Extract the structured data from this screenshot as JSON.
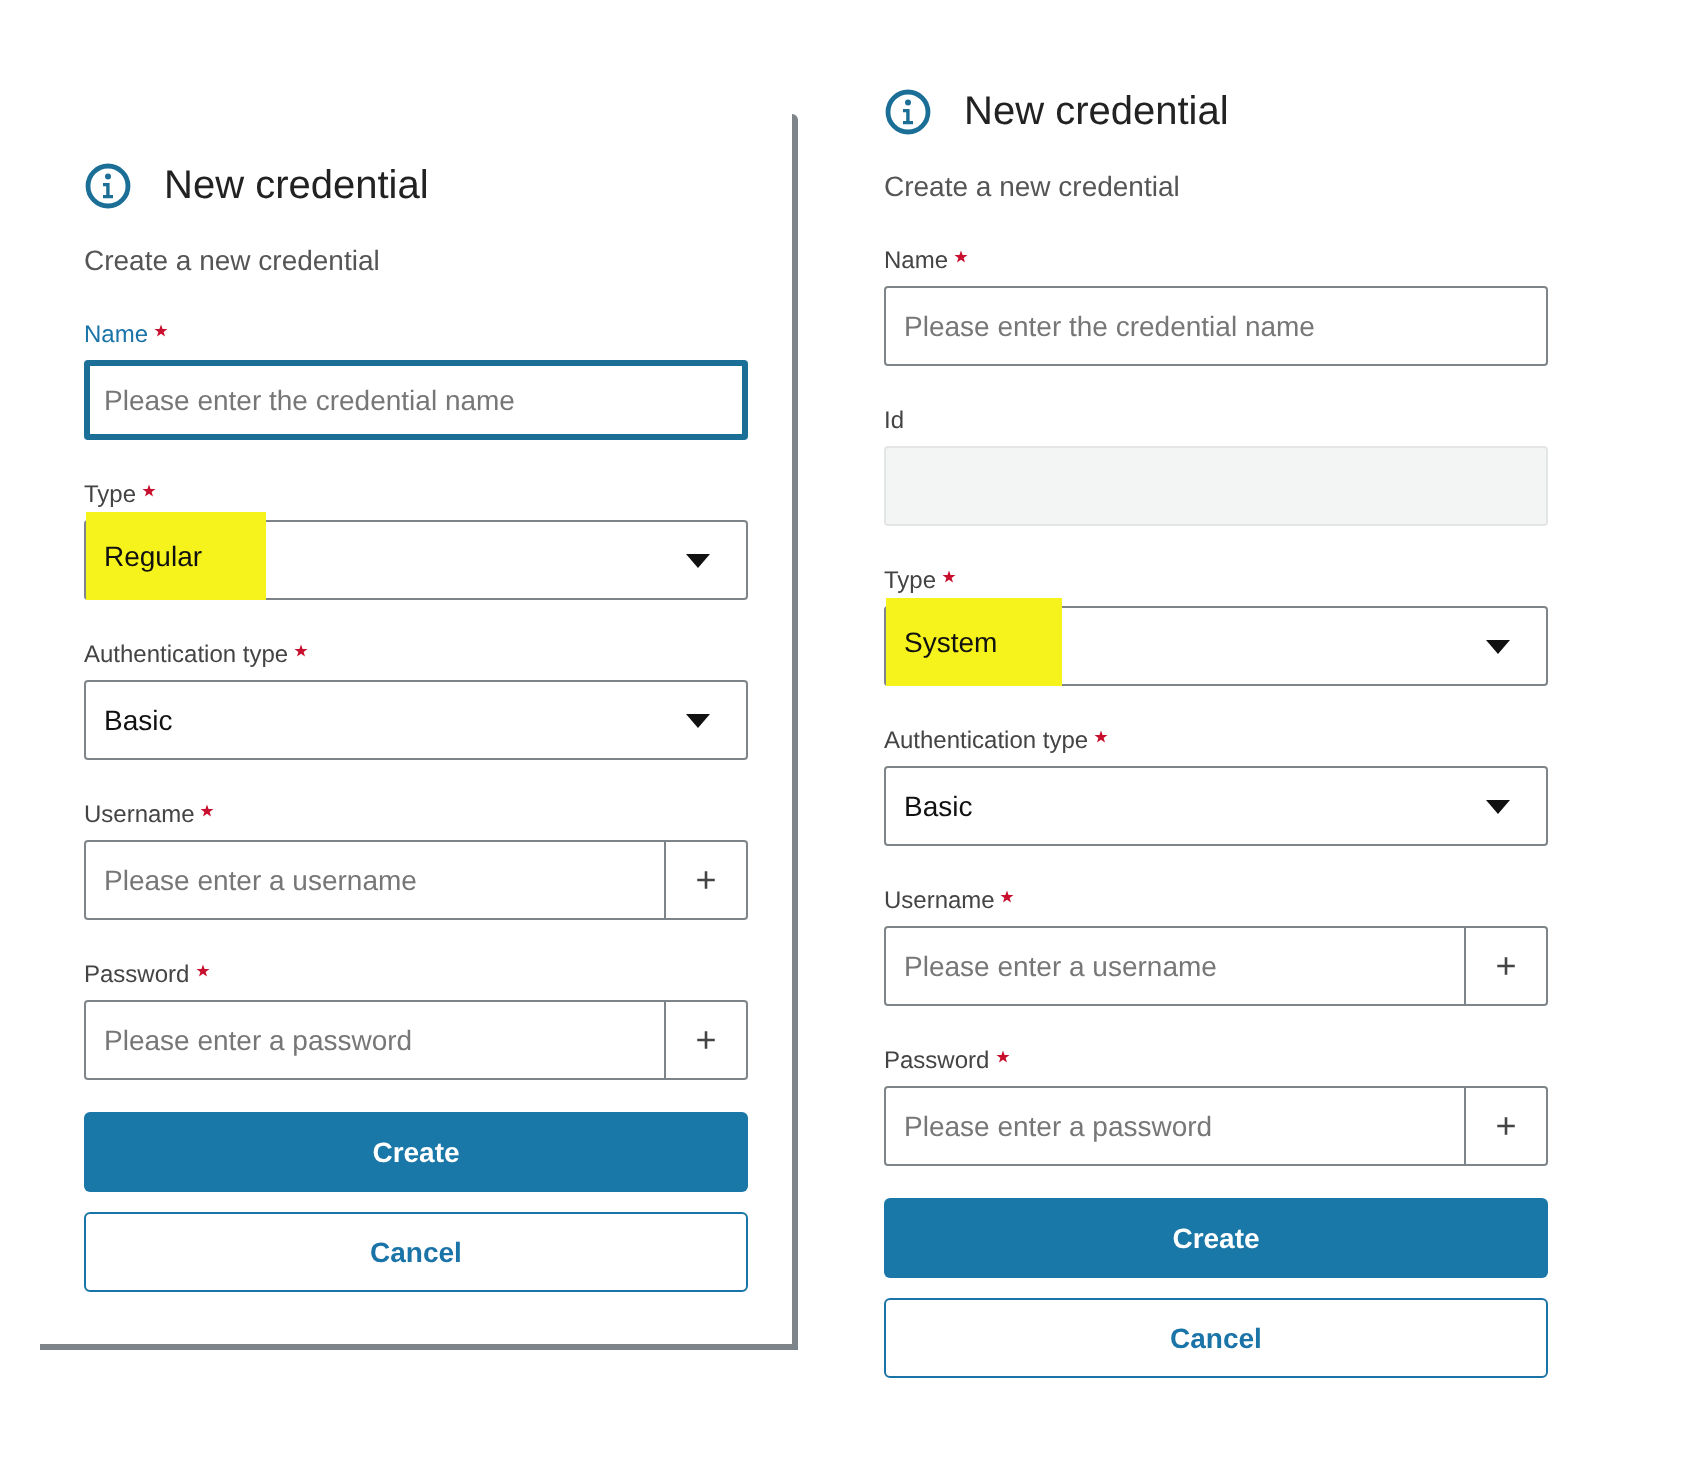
{
  "dialogs": [
    {
      "framed": true,
      "title": "New credential",
      "subtitle": "Create a new credential",
      "fields": [
        {
          "kind": "text",
          "label": "Name",
          "required": true,
          "focused": true,
          "placeholder": "Please enter the credential name"
        },
        {
          "kind": "select",
          "label": "Type",
          "required": true,
          "focused": false,
          "value": "Regular",
          "highlighted": true
        },
        {
          "kind": "select",
          "label": "Authentication type",
          "required": true,
          "focused": false,
          "value": "Basic",
          "highlighted": false
        },
        {
          "kind": "addon",
          "label": "Username",
          "required": true,
          "focused": false,
          "placeholder": "Please enter a username",
          "addon": "+"
        },
        {
          "kind": "addon",
          "label": "Password",
          "required": true,
          "focused": false,
          "placeholder": "Please enter a password",
          "addon": "+"
        }
      ],
      "buttons": [
        {
          "kind": "primary",
          "label": "Create"
        },
        {
          "kind": "secondary",
          "label": "Cancel"
        }
      ]
    },
    {
      "framed": false,
      "title": "New credential",
      "subtitle": "Create a new credential",
      "fields": [
        {
          "kind": "text",
          "label": "Name",
          "required": true,
          "focused": false,
          "placeholder": "Please enter the credential name"
        },
        {
          "kind": "readonly",
          "label": "Id",
          "required": false,
          "focused": false
        },
        {
          "kind": "select",
          "label": "Type",
          "required": true,
          "focused": false,
          "value": "System",
          "highlighted": true
        },
        {
          "kind": "select",
          "label": "Authentication type",
          "required": true,
          "focused": false,
          "value": "Basic",
          "highlighted": false
        },
        {
          "kind": "addon",
          "label": "Username",
          "required": true,
          "focused": false,
          "placeholder": "Please enter a username",
          "addon": "+"
        },
        {
          "kind": "addon",
          "label": "Password",
          "required": true,
          "focused": false,
          "placeholder": "Please enter a password",
          "addon": "+"
        }
      ],
      "buttons": [
        {
          "kind": "primary",
          "label": "Create"
        },
        {
          "kind": "secondary",
          "label": "Cancel"
        }
      ]
    }
  ]
}
